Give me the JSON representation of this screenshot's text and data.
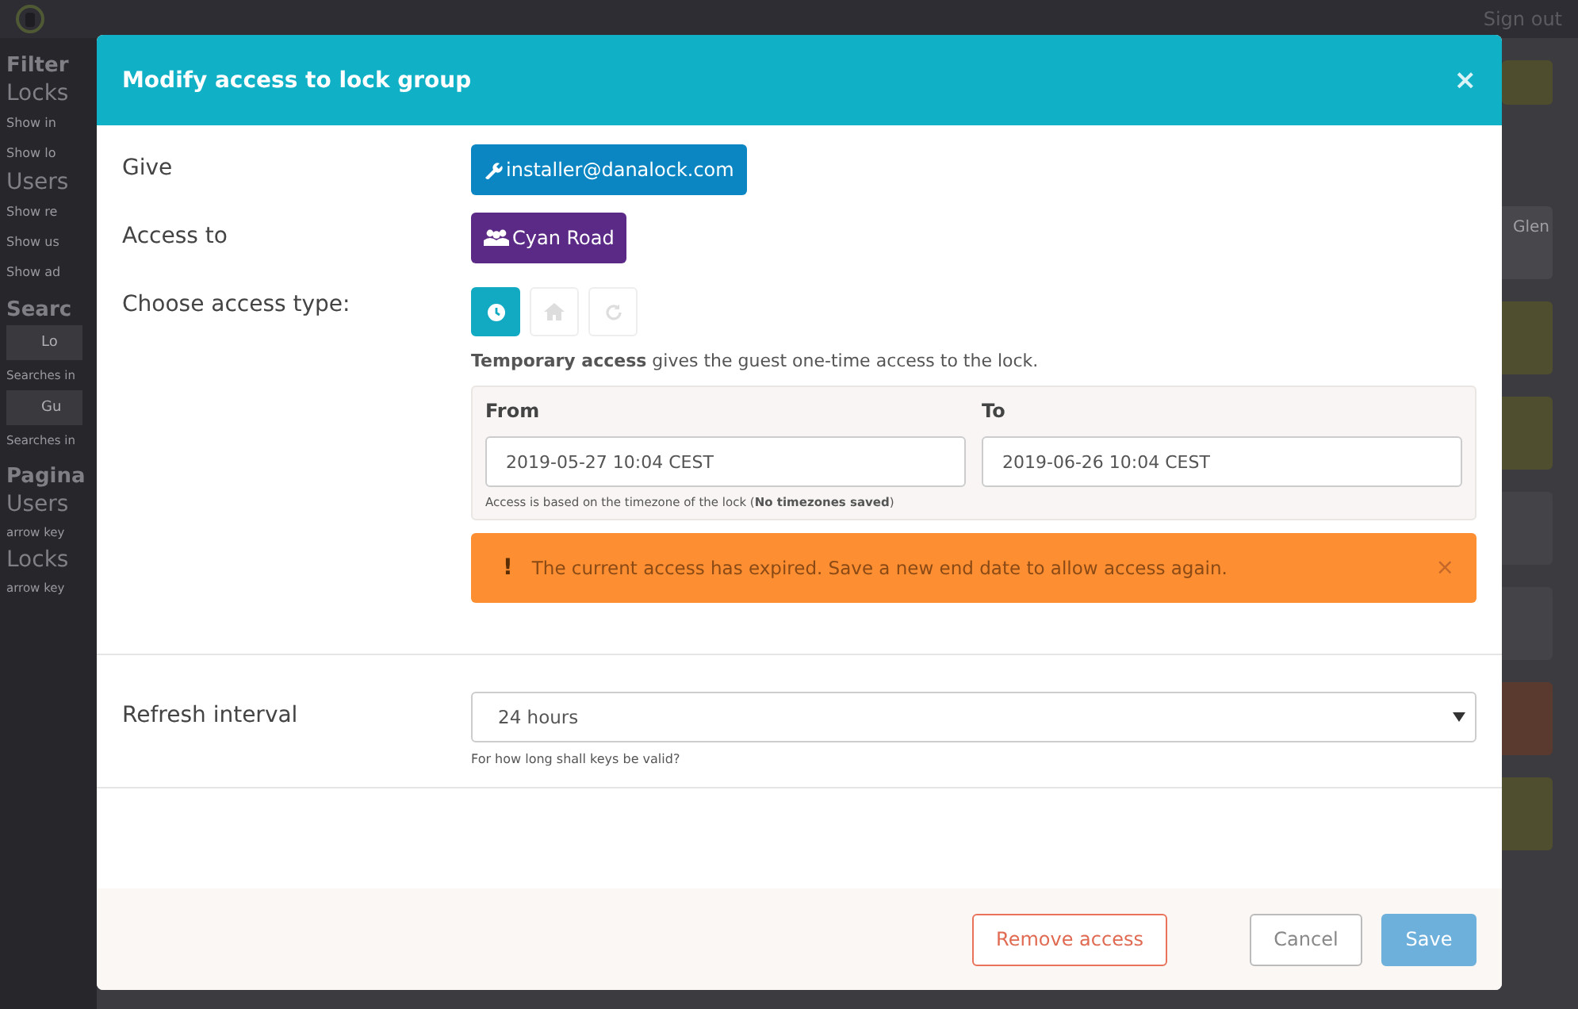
{
  "background": {
    "top_bar": {
      "sign_out": "Sign out"
    },
    "sidebar": [
      {
        "kind": "heading",
        "text": "Filter"
      },
      {
        "kind": "subheading",
        "text": "Locks"
      },
      {
        "kind": "item",
        "text": "Show in"
      },
      {
        "kind": "item",
        "text": "Show lo"
      },
      {
        "kind": "subheading",
        "text": "Users"
      },
      {
        "kind": "item",
        "text": "Show re"
      },
      {
        "kind": "item",
        "text": "Show us"
      },
      {
        "kind": "item",
        "text": "Show ad"
      },
      {
        "kind": "heading",
        "text": "Searc"
      },
      {
        "kind": "field",
        "text": "Lo"
      },
      {
        "kind": "note",
        "text": "Searches in"
      },
      {
        "kind": "field",
        "text": "Gu"
      },
      {
        "kind": "note",
        "text": "Searches in"
      },
      {
        "kind": "heading",
        "text": "Pagina"
      },
      {
        "kind": "subheading",
        "text": "Users"
      },
      {
        "kind": "note",
        "text": "arrow key"
      },
      {
        "kind": "subheading",
        "text": "Locks"
      },
      {
        "kind": "note",
        "text": "arrow key"
      }
    ],
    "side_cards": [
      {
        "kind": "select"
      },
      {
        "kind": "text",
        "text": "Glen"
      },
      {
        "kind": "olive"
      },
      {
        "kind": "olive"
      },
      {
        "kind": "plain"
      },
      {
        "kind": "plain"
      },
      {
        "kind": "brown"
      },
      {
        "kind": "olive"
      }
    ]
  },
  "modal": {
    "title": "Modify access to lock group",
    "close": "×",
    "give": {
      "label": "Give",
      "value": "installer@danalock.com"
    },
    "access_to": {
      "label": "Access to",
      "value": "Cyan Road"
    },
    "access_type": {
      "label": "Choose access type:",
      "options": [
        {
          "kind": "clock",
          "selected": true
        },
        {
          "kind": "home",
          "selected": false
        },
        {
          "kind": "repeat",
          "selected": false
        }
      ],
      "description": "**Temporary access** gives the guest one-time access to the lock."
    },
    "period": {
      "from": {
        "label": "From",
        "value": "2019-05-27 10:04 CEST"
      },
      "to": {
        "label": "To",
        "value": "2019-06-26 10:04 CEST"
      },
      "note": "Access is based on the timezone of the lock (**No timezones saved**)"
    },
    "alert": {
      "icon": "!",
      "text": "The current access has expired. Save a new end date to allow access again.",
      "close": "×"
    },
    "refresh": {
      "label": "Refresh interval",
      "value": "24 hours",
      "hint": "For how long shall keys be valid?"
    },
    "buttons": [
      {
        "kind": "danger",
        "label": "Remove access"
      },
      {
        "kind": "default",
        "label": "Cancel"
      },
      {
        "kind": "primary",
        "label": "Save"
      }
    ]
  }
}
